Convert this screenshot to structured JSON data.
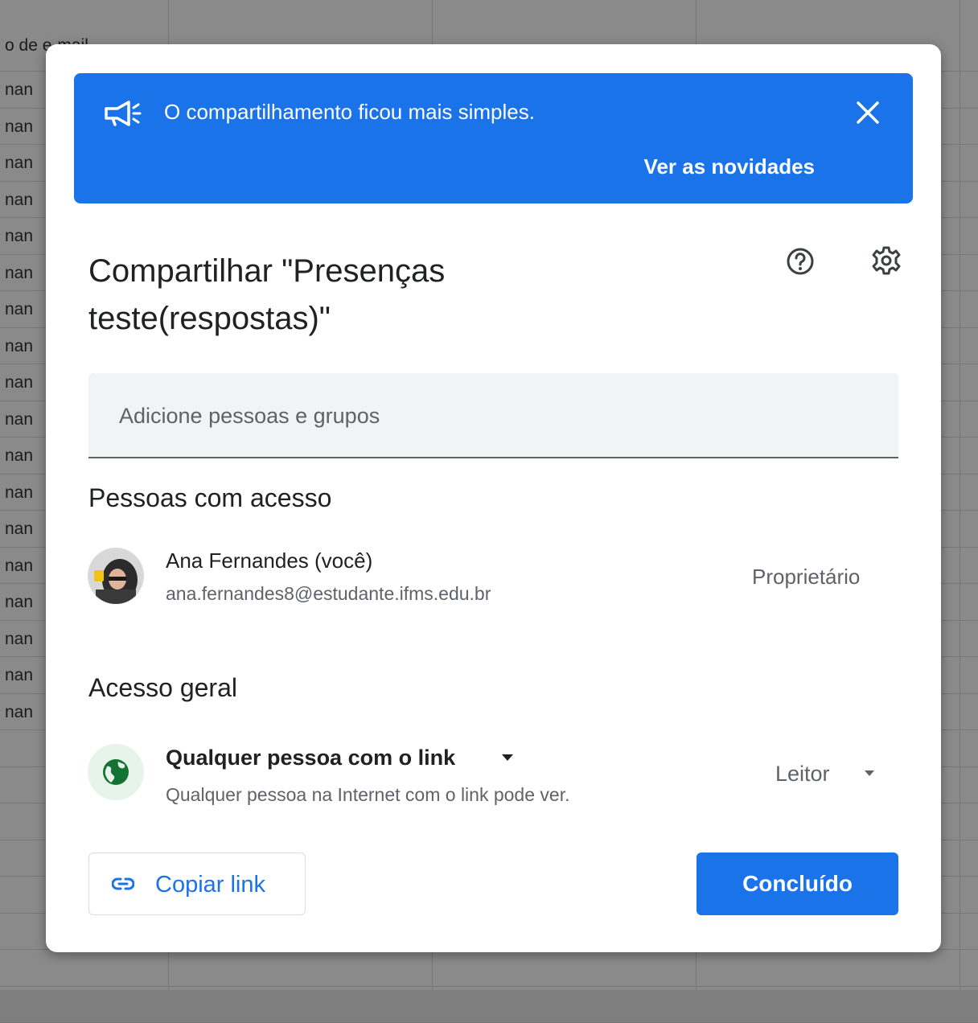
{
  "background_sheet": {
    "header_cell": "o de e-mail",
    "row_cells": [
      "nan",
      "nan",
      "nan",
      "nan",
      "nan",
      "nan",
      "nan",
      "nan",
      "nan",
      "nan",
      "nan",
      "nan",
      "nan",
      "nan",
      "nan",
      "nan",
      "nan",
      "nan"
    ]
  },
  "banner": {
    "message": "O compartilhamento ficou mais simples.",
    "link_label": "Ver as novidades",
    "icon": "megaphone-icon",
    "close_icon": "close-icon",
    "color": "#1a73e8"
  },
  "dialog": {
    "title": "Compartilhar \"Presenças teste(respostas)\"",
    "help_icon": "help-icon",
    "settings_icon": "gear-icon"
  },
  "add_people": {
    "placeholder": "Adicione pessoas e grupos",
    "value": ""
  },
  "people_with_access": {
    "heading": "Pessoas com acesso",
    "people": [
      {
        "name": "Ana Fernandes (você)",
        "email": "ana.fernandes8@estudante.ifms.edu.br",
        "role": "Proprietário"
      }
    ]
  },
  "general_access": {
    "heading": "Acesso geral",
    "type": "Qualquer pessoa com o link",
    "description": "Qualquer pessoa na Internet com o link pode ver.",
    "role": "Leitor",
    "icon": "globe-icon"
  },
  "footer": {
    "copy_link": "Copiar link",
    "done": "Concluído",
    "accent": "#1a73e8"
  }
}
